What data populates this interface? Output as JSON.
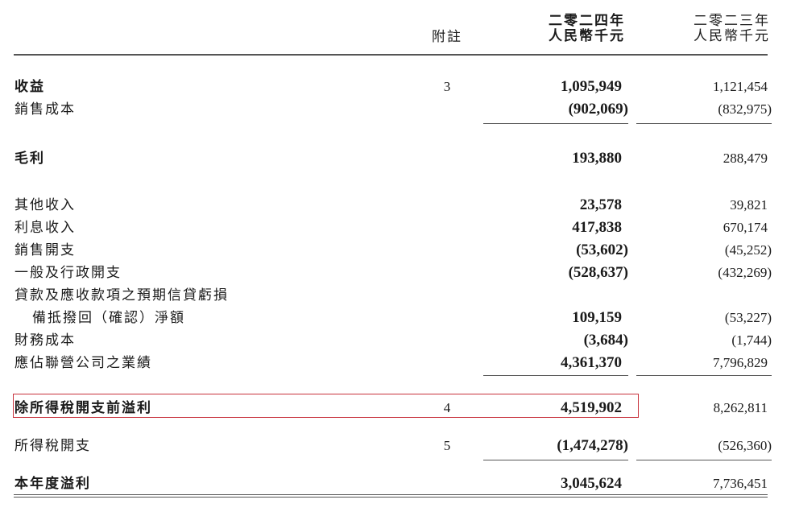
{
  "header": {
    "note_label": "附註",
    "cur_year": "二零二四年",
    "cur_unit": "人民幣千元",
    "prev_year": "二零二三年",
    "prev_unit": "人民幣千元"
  },
  "rows": [
    {
      "label": "收益",
      "note": "3",
      "v2024": "1,095,949",
      "v2023": "1,121,454"
    },
    {
      "label": "銷售成本",
      "note": "",
      "v2024": "(902,069)",
      "v2023": "(832,975)"
    },
    {
      "label": "毛利",
      "note": "",
      "v2024": "193,880",
      "v2023": "288,479"
    },
    {
      "label": "其他收入",
      "note": "",
      "v2024": "23,578",
      "v2023": "39,821"
    },
    {
      "label": "利息收入",
      "note": "",
      "v2024": "417,838",
      "v2023": "670,174"
    },
    {
      "label": "銷售開支",
      "note": "",
      "v2024": "(53,602)",
      "v2023": "(45,252)"
    },
    {
      "label": "一般及行政開支",
      "note": "",
      "v2024": "(528,637)",
      "v2023": "(432,269)"
    },
    {
      "label": "貸款及應收款項之預期信貸虧損",
      "note": "",
      "v2024": "",
      "v2023": ""
    },
    {
      "label": "備抵撥回（確認）淨額",
      "note": "",
      "v2024": "109,159",
      "v2023": "(53,227)"
    },
    {
      "label": "財務成本",
      "note": "",
      "v2024": "(3,684)",
      "v2023": "(1,744)"
    },
    {
      "label": "應佔聯營公司之業績",
      "note": "",
      "v2024": "4,361,370",
      "v2023": "7,796,829"
    },
    {
      "label": "除所得稅開支前溢利",
      "note": "4",
      "v2024": "4,519,902",
      "v2023": "8,262,811"
    },
    {
      "label": "所得稅開支",
      "note": "5",
      "v2024": "(1,474,278)",
      "v2023": "(526,360)"
    },
    {
      "label": "本年度溢利",
      "note": "",
      "v2024": "3,045,624",
      "v2023": "7,736,451"
    }
  ]
}
